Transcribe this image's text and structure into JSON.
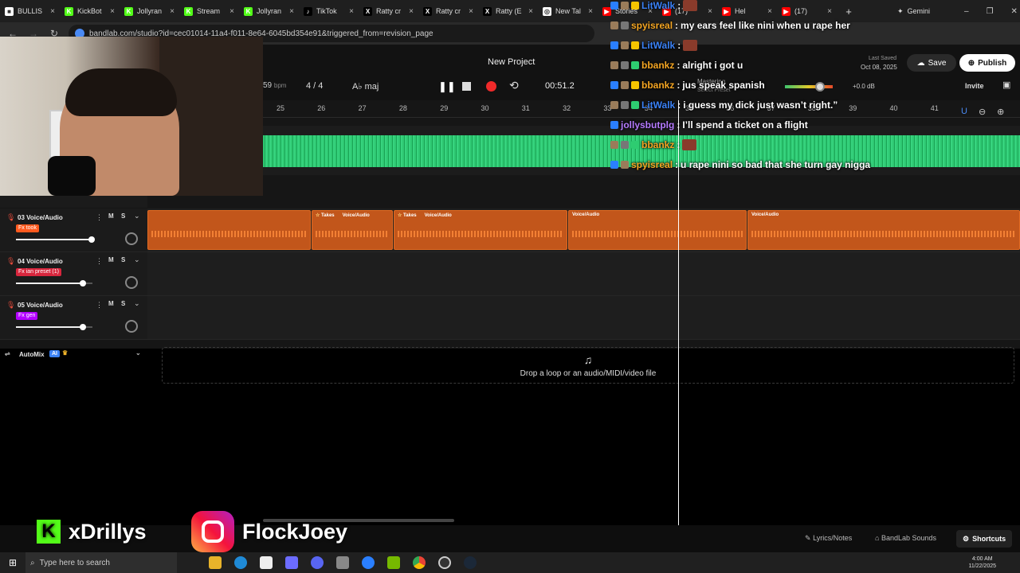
{
  "browser": {
    "tabs": [
      {
        "label": "BULLIS",
        "color": "#ffffff",
        "glyph": "■"
      },
      {
        "label": "KickBot",
        "color": "#53fc18",
        "glyph": "K"
      },
      {
        "label": "Jollyran",
        "color": "#53fc18",
        "glyph": "K"
      },
      {
        "label": "Stream",
        "color": "#53fc18",
        "glyph": "K"
      },
      {
        "label": "Jollyran",
        "color": "#53fc18",
        "glyph": "K"
      },
      {
        "label": "TikTok",
        "color": "#000000",
        "glyph": "♪"
      },
      {
        "label": "Ratty cr",
        "color": "#000000",
        "glyph": "X"
      },
      {
        "label": "Ratty cr",
        "color": "#000000",
        "glyph": "X"
      },
      {
        "label": "Ratty (E",
        "color": "#000000",
        "glyph": "X"
      },
      {
        "label": "New Tal",
        "color": "#ffffff",
        "glyph": "◎"
      },
      {
        "label": "Stories",
        "color": "#ff0000",
        "glyph": "▶"
      },
      {
        "label": "(17)",
        "color": "#ff0000",
        "glyph": "▶"
      },
      {
        "label": "Hel",
        "color": "#ff0000",
        "glyph": "▶"
      },
      {
        "label": "(17)",
        "color": "#ff0000",
        "glyph": "▶"
      }
    ],
    "extra_tab": "Gemini",
    "url": "bandlab.com/studio?id=cec01014-11a4-f011-8e64-6045bd354e91&triggered_from=revision_page"
  },
  "studio": {
    "project_title": "New Project",
    "bpm_value": "59",
    "bpm_unit": "bpm",
    "time_signature": "4 / 4",
    "key": "A♭ maj",
    "time": "00:51.2",
    "last_saved_label": "Last Saved",
    "last_saved_date": "Oct 08, 2025",
    "save_label": "Save",
    "publish_label": "Publish",
    "invite_label": "Invite",
    "master_db": "+0.0 dB",
    "master_label": "Mastering",
    "preset_label": "Select Preset",
    "timeline": [
      "25",
      "26",
      "27",
      "28",
      "29",
      "30",
      "31",
      "32",
      "33",
      "34",
      "35",
      "36",
      "37",
      "38",
      "39",
      "40",
      "41"
    ],
    "tracks": [
      {
        "num": "03",
        "name": "Voice/Audio",
        "fx": "Fx took",
        "fx_color": "#ff5a1f"
      },
      {
        "num": "04",
        "name": "Voice/Audio",
        "fx": "Fx ian preset (1)",
        "fx_color": "#d7263d"
      },
      {
        "num": "05",
        "name": "Voice/Audio",
        "fx": "Fx gen",
        "fx_color": "#b300ff"
      }
    ],
    "mute": "M",
    "solo": "S",
    "clips": [
      {
        "label": "",
        "takes": false
      },
      {
        "label": "Voice/Audio",
        "takes": true
      },
      {
        "label": "Voice/Audio",
        "takes": true
      },
      {
        "label": "Voice/Audio",
        "takes": false
      },
      {
        "label": "Voice/Audio",
        "takes": false
      }
    ],
    "takes_label": "Takes",
    "automix": "AutoMix",
    "ai_badge": "AI",
    "drop_text": "Drop a loop or an audio/MIDI/video file",
    "footer": {
      "lyrics": "Lyrics/Notes",
      "sounds": "BandLab Sounds",
      "shortcuts": "Shortcuts"
    }
  },
  "chat": [
    {
      "user": "LitWalk",
      "user_color": "#3b82f6",
      "msg": "",
      "emote": true
    },
    {
      "user": "spyisreal",
      "user_color": "#f5a623",
      "msg": "my ears feel like nini when u rape her",
      "emote": false
    },
    {
      "user": "LitWalk",
      "user_color": "#3b82f6",
      "msg": "",
      "emote": true
    },
    {
      "user": "bbankz",
      "user_color": "#f5a623",
      "msg": "alright i got u",
      "emote": false
    },
    {
      "user": "bbankz",
      "user_color": "#f5a623",
      "msg": "jus speak spanish",
      "emote": false
    },
    {
      "user": "LitWalk",
      "user_color": "#3b82f6",
      "msg": "i guess my dick just wasn’t right.”",
      "emote": false
    },
    {
      "user": "jollysbutplg",
      "user_color": "#b57bff",
      "msg": "I’ll spend a ticket on a flight",
      "emote": false
    },
    {
      "user": "bbankz",
      "user_color": "#f5a623",
      "msg": "",
      "emote": true
    },
    {
      "user": "spyisreal",
      "user_color": "#f5a623",
      "msg": "u rape nini so bad that she turn gay nigga",
      "emote": false
    }
  ],
  "socials": {
    "kick": "xDrillys",
    "instagram": "FlockJoey"
  },
  "taskbar": {
    "search_placeholder": "Type here to search",
    "time": "4:00 AM",
    "date": "11/22/2025"
  }
}
